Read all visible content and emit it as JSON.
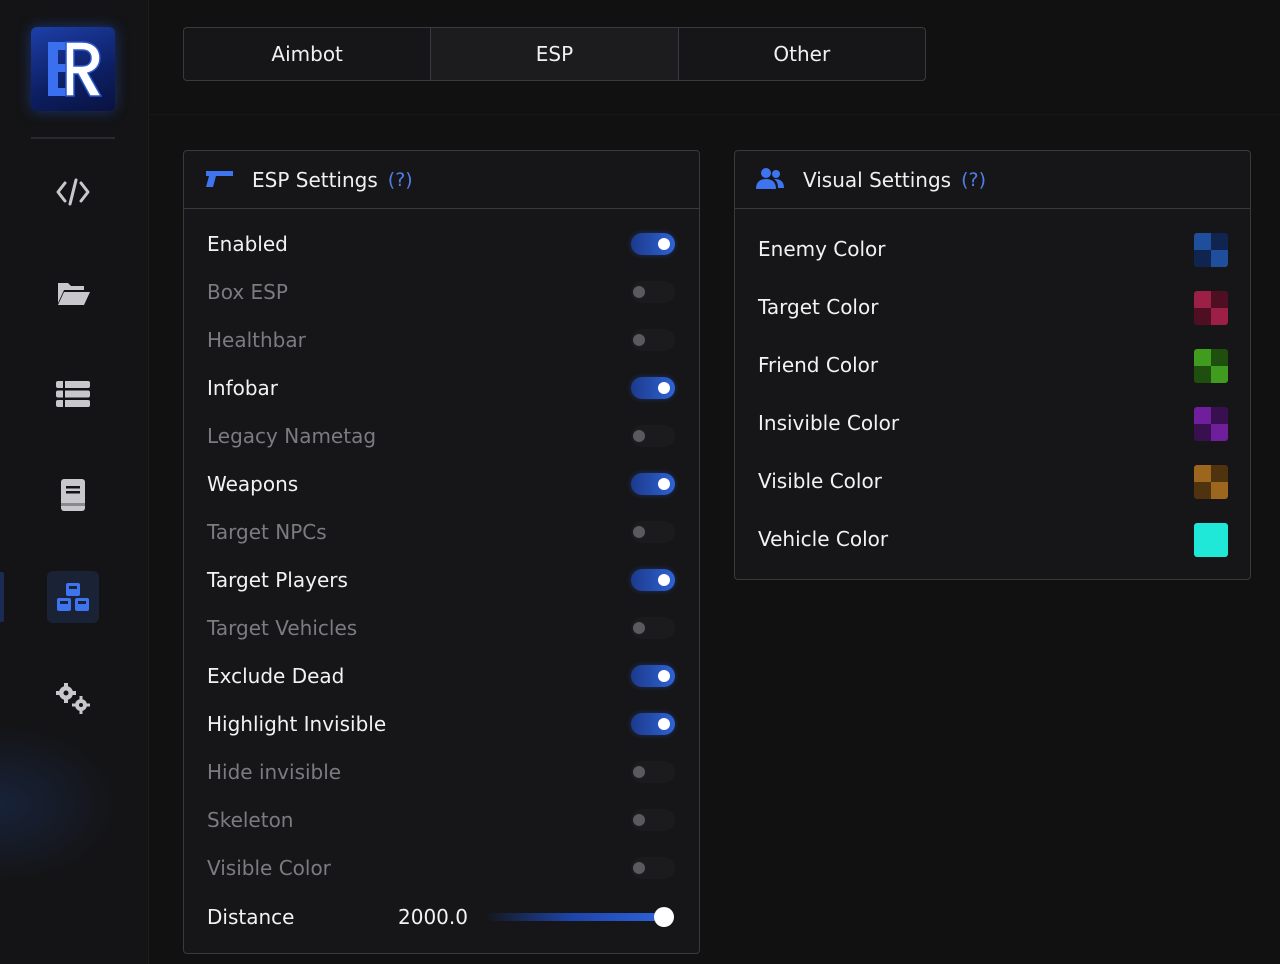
{
  "sidebar": {
    "logo_letters": "ER",
    "items": [
      {
        "name": "code",
        "icon": "code-icon",
        "active": false
      },
      {
        "name": "files",
        "icon": "folder-open-icon",
        "active": false
      },
      {
        "name": "list",
        "icon": "list-icon",
        "active": false
      },
      {
        "name": "book",
        "icon": "book-icon",
        "active": false
      },
      {
        "name": "cubes",
        "icon": "cubes-icon",
        "active": true
      },
      {
        "name": "settings",
        "icon": "gears-icon",
        "active": false
      }
    ]
  },
  "tabs": [
    {
      "label": "Aimbot",
      "active": false
    },
    {
      "label": "ESP",
      "active": true
    },
    {
      "label": "Other",
      "active": false
    }
  ],
  "esp_panel": {
    "title": "ESP Settings",
    "help": "(?)",
    "icon": "pistol-icon",
    "toggles": [
      {
        "label": "Enabled",
        "on": true
      },
      {
        "label": "Box ESP",
        "on": false
      },
      {
        "label": "Healthbar",
        "on": false
      },
      {
        "label": "Infobar",
        "on": true
      },
      {
        "label": "Legacy Nametag",
        "on": false
      },
      {
        "label": "Weapons",
        "on": true
      },
      {
        "label": "Target NPCs",
        "on": false
      },
      {
        "label": "Target Players",
        "on": true
      },
      {
        "label": "Target Vehicles",
        "on": false
      },
      {
        "label": "Exclude Dead",
        "on": true
      },
      {
        "label": "Highlight Invisible",
        "on": true
      },
      {
        "label": "Hide invisible",
        "on": false
      },
      {
        "label": "Skeleton",
        "on": false
      },
      {
        "label": "Visible Color",
        "on": false
      }
    ],
    "distance": {
      "label": "Distance",
      "value": "2000.0",
      "fraction": 1.0
    }
  },
  "visual_panel": {
    "title": "Visual Settings",
    "help": "(?)",
    "icon": "users-icon",
    "colors": [
      {
        "label": "Enemy Color",
        "a": "#1f4f9c",
        "b": "#0f2550"
      },
      {
        "label": "Target Color",
        "a": "#9c1f45",
        "b": "#4f0f22"
      },
      {
        "label": "Friend Color",
        "a": "#3f9c1f",
        "b": "#1f4f0f"
      },
      {
        "label": "Insivible Color",
        "a": "#6f1f9c",
        "b": "#38104f"
      },
      {
        "label": "Visible Color",
        "a": "#9c661f",
        "b": "#4f330f"
      },
      {
        "label": "Vehicle Color",
        "a": "#1fe8d8",
        "b": "#1fe8d8"
      }
    ]
  },
  "accent": "#2f63d6"
}
